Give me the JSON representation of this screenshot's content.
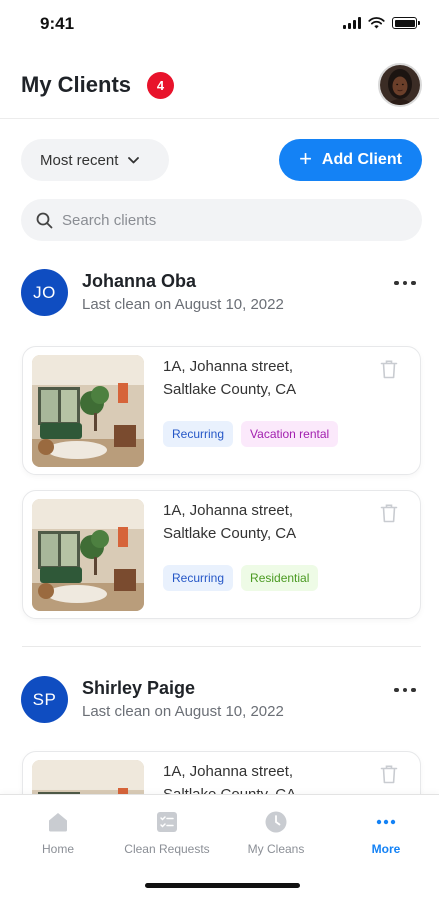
{
  "status_bar": {
    "time": "9:41"
  },
  "header": {
    "title": "My Clients",
    "client_count": "4"
  },
  "controls": {
    "sort_label": "Most recent",
    "add_client_label": "Add Client",
    "search_placeholder": "Search clients"
  },
  "clients": [
    {
      "initials": "JO",
      "name": "Johanna Oba",
      "last_clean": "Last clean on August 10, 2022",
      "properties": [
        {
          "address_line1": "1A, Johanna street,",
          "address_line2": "Saltlake County, CA",
          "tags": [
            "Recurring",
            "Vacation rental"
          ]
        },
        {
          "address_line1": "1A, Johanna street,",
          "address_line2": "Saltlake County, CA",
          "tags": [
            "Recurring",
            "Residential"
          ]
        }
      ]
    },
    {
      "initials": "SP",
      "name": "Shirley Paige",
      "last_clean": "Last clean on August 10, 2022",
      "properties": [
        {
          "address_line1": "1A, Johanna street,",
          "address_line2": "Saltlake County, CA",
          "tags": []
        }
      ]
    }
  ],
  "bottom_nav": {
    "items": [
      {
        "label": "Home",
        "icon": "home-icon"
      },
      {
        "label": "Clean Requests",
        "icon": "checklist-icon"
      },
      {
        "label": "My Cleans",
        "icon": "clock-icon"
      },
      {
        "label": "More",
        "icon": "more-icon",
        "active": true
      }
    ]
  },
  "colors": {
    "accent": "#1482f5",
    "badge": "#e8132b",
    "client_avatar": "#0f4dc1",
    "tag_recurring": "#2557c7",
    "tag_vacation": "#a21faf",
    "tag_residential": "#4b9a22"
  }
}
